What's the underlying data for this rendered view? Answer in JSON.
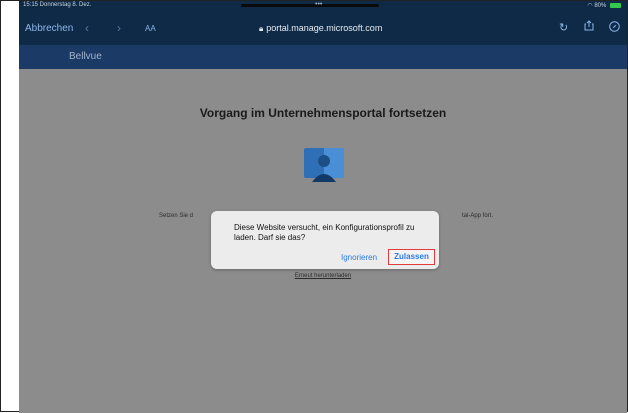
{
  "status_bar": {
    "time_date": "15:15  Donnerstag 8. Dez.",
    "dots": "•••",
    "right": "80%"
  },
  "safari": {
    "cancel_label": "Abbrechen",
    "back_icon": "chevron-left-icon",
    "forward_icon": "chevron-right-icon",
    "text_size_label": "AA",
    "url": "portal.manage.microsoft.com"
  },
  "site": {
    "brand": "Bellvue",
    "heading": "Vorgang im Unternehmensportal fortsetzen",
    "text_left": "Setzen Sie d",
    "text_right": "tal-App fort.",
    "redownload_link": "Erneut herunterladen"
  },
  "dialog": {
    "message": "Diese Website versucht, ein Konfigurationsprofil zu laden. Darf sie das?",
    "ignore_label": "Ignorieren",
    "allow_label": "Zulassen",
    "highlight_color": "#e23b3b"
  },
  "colors": {
    "topbar": "#0e2a47",
    "brandbar": "#1b3a66",
    "page_bg": "#8c8c8c",
    "link_blue": "#2c7be5"
  }
}
